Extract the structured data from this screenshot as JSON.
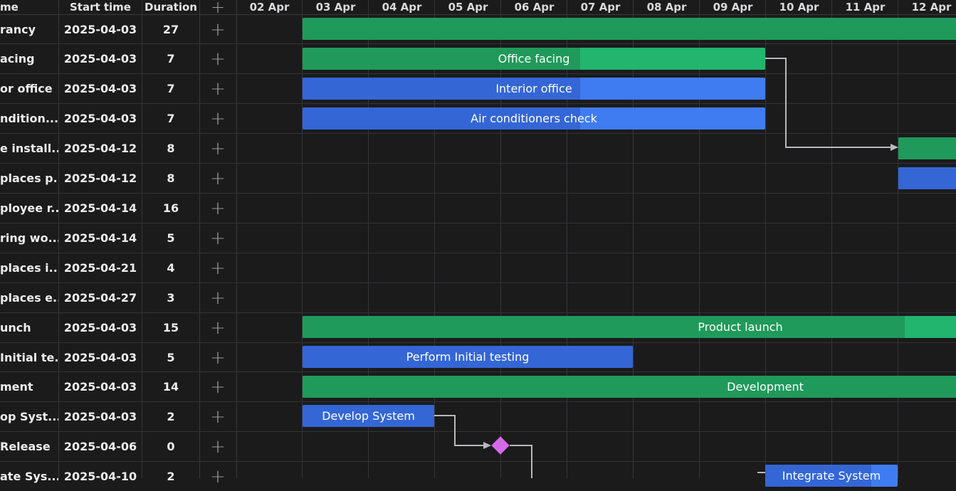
{
  "columns": {
    "name": "me",
    "start": "Start time",
    "duration": "Duration",
    "add": "+"
  },
  "days": [
    "02 Apr",
    "03 Apr",
    "04 Apr",
    "05 Apr",
    "06 Apr",
    "07 Apr",
    "08 Apr",
    "09 Apr",
    "10 Apr",
    "11 Apr",
    "12 Apr"
  ],
  "rows": [
    {
      "name": "rancy",
      "start": "2025-04-03",
      "duration": "27",
      "add": "+"
    },
    {
      "name": "acing",
      "start": "2025-04-03",
      "duration": "7",
      "add": "+"
    },
    {
      "name": "or office",
      "start": "2025-04-03",
      "duration": "7",
      "add": "+"
    },
    {
      "name": "ndition...",
      "start": "2025-04-03",
      "duration": "7",
      "add": "+"
    },
    {
      "name": "e install...",
      "start": "2025-04-12",
      "duration": "8",
      "add": "+"
    },
    {
      "name": "places p...",
      "start": "2025-04-12",
      "duration": "8",
      "add": "+"
    },
    {
      "name": "ployee r...",
      "start": "2025-04-14",
      "duration": "16",
      "add": "+"
    },
    {
      "name": "ring wo...",
      "start": "2025-04-14",
      "duration": "5",
      "add": "+"
    },
    {
      "name": "places i...",
      "start": "2025-04-21",
      "duration": "4",
      "add": "+"
    },
    {
      "name": "places e...",
      "start": "2025-04-27",
      "duration": "3",
      "add": "+"
    },
    {
      "name": "unch",
      "start": "2025-04-03",
      "duration": "15",
      "add": "+"
    },
    {
      "name": "Initial te...",
      "start": "2025-04-03",
      "duration": "5",
      "add": "+"
    },
    {
      "name": "ment",
      "start": "2025-04-03",
      "duration": "14",
      "add": "+"
    },
    {
      "name": "op Syst...",
      "start": "2025-04-03",
      "duration": "2",
      "add": "+"
    },
    {
      "name": "Release",
      "start": "2025-04-06",
      "duration": "0",
      "add": "+"
    },
    {
      "name": "ate Sys...",
      "start": "2025-04-10",
      "duration": "2",
      "add": "+"
    }
  ],
  "bars": {
    "b0": {
      "label": "",
      "progress": 1.0
    },
    "b1": {
      "label": "Office facing",
      "progress": 0.6
    },
    "b2": {
      "label": "Interior office",
      "progress": 0.6
    },
    "b3": {
      "label": "Air conditioners check",
      "progress": 0.6
    },
    "b4": {
      "label": "",
      "progress": 1.0
    },
    "b5": {
      "label": "",
      "progress": 1.0
    },
    "b10": {
      "label": "Product launch",
      "progress": 0.91
    },
    "b11": {
      "label": "Perform Initial testing",
      "progress": 1.0
    },
    "b12": {
      "label": "Development",
      "progress": 1.0
    },
    "b13": {
      "label": "Develop System",
      "progress": 1.0
    },
    "b15": {
      "label": "Integrate System",
      "progress": 0.8
    }
  },
  "colors": {
    "summary": "#21b56d",
    "summary_progress": "#1f9a5a",
    "task": "#3f7cf2",
    "task_progress": "#3466d6",
    "milestone": "#d46ae8"
  }
}
